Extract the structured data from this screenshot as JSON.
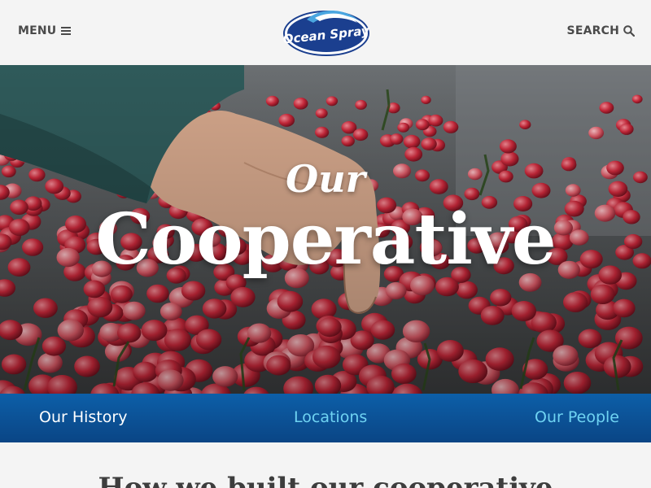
{
  "header": {
    "menu_label": "MENU",
    "search_label": "SEARCH",
    "logo_text": "Ocean Spray"
  },
  "hero": {
    "kicker": "Our",
    "title": "Cooperative"
  },
  "subnav": {
    "items": [
      {
        "label": "Our History",
        "active": true
      },
      {
        "label": "Locations",
        "active": false
      },
      {
        "label": "Our People",
        "active": false
      }
    ]
  },
  "section": {
    "heading": "How we built our cooperative"
  },
  "colors": {
    "brand_blue": "#0a4585",
    "subnav_link": "#6fd3f2",
    "cranberry": "#c8283a"
  },
  "icons": [
    "hamburger-icon",
    "search-icon",
    "ocean-spray-logo"
  ]
}
